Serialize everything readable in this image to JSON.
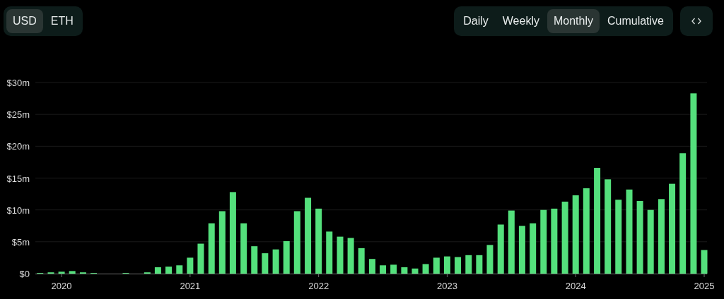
{
  "currency_toggle": [
    {
      "label": "USD",
      "selected": true
    },
    {
      "label": "ETH",
      "selected": false
    }
  ],
  "period_toggle": [
    {
      "label": "Daily",
      "selected": false
    },
    {
      "label": "Weekly",
      "selected": false
    },
    {
      "label": "Monthly",
      "selected": true
    },
    {
      "label": "Cumulative",
      "selected": false
    }
  ],
  "chart_data": {
    "type": "bar",
    "x": [
      2019.833,
      2019.917,
      2020.0,
      2020.083,
      2020.167,
      2020.25,
      2020.333,
      2020.417,
      2020.5,
      2020.583,
      2020.667,
      2020.75,
      2020.833,
      2020.917,
      2021.0,
      2021.083,
      2021.167,
      2021.25,
      2021.333,
      2021.417,
      2021.5,
      2021.583,
      2021.667,
      2021.75,
      2021.833,
      2021.917,
      2022.0,
      2022.083,
      2022.167,
      2022.25,
      2022.333,
      2022.417,
      2022.5,
      2022.583,
      2022.667,
      2022.75,
      2022.833,
      2022.917,
      2023.0,
      2023.083,
      2023.167,
      2023.25,
      2023.333,
      2023.417,
      2023.5,
      2023.583,
      2023.667,
      2023.75,
      2023.833,
      2023.917,
      2024.0,
      2024.083,
      2024.167,
      2024.25,
      2024.333,
      2024.417,
      2024.5,
      2024.583,
      2024.667,
      2024.75,
      2024.833,
      2024.917,
      2025.0
    ],
    "series": [
      {
        "color": "#54e07c",
        "values": [
          0.1,
          0.2,
          0.3,
          0.4,
          0.2,
          0.1,
          0,
          0,
          0.1,
          0,
          0.2,
          1.0,
          1.1,
          1.3,
          2.5,
          4.7,
          7.9,
          9.8,
          12.8,
          7.9,
          4.3,
          3.2,
          3.8,
          5.1,
          9.8,
          11.9,
          10.2,
          6.6,
          5.8,
          5.6,
          4.0,
          2.3,
          1.3,
          1.4,
          1.0,
          0.8,
          1.5,
          2.5,
          2.7,
          2.6,
          2.9,
          2.9,
          4.5,
          7.7,
          9.9,
          7.5,
          7.9,
          10.0,
          10.2,
          11.3,
          12.3,
          13.4,
          16.6,
          14.8,
          11.6,
          13.2,
          11.4,
          10.0,
          11.7,
          14.1,
          18.9,
          28.3,
          3.7
        ]
      }
    ],
    "grid": true,
    "xlim": [
      2019.796,
      2025.022
    ],
    "ylim": [
      0,
      30
    ],
    "yticks": [
      {
        "value": 0,
        "label": "$0"
      },
      {
        "value": 5,
        "label": "$5m"
      },
      {
        "value": 10,
        "label": "$10m"
      },
      {
        "value": 15,
        "label": "$15m"
      },
      {
        "value": 20,
        "label": "$20m"
      },
      {
        "value": 25,
        "label": "$25m"
      },
      {
        "value": 30,
        "label": "$30m"
      }
    ],
    "xticks": [
      2020,
      2021,
      2022,
      2023,
      2024,
      2025
    ]
  }
}
